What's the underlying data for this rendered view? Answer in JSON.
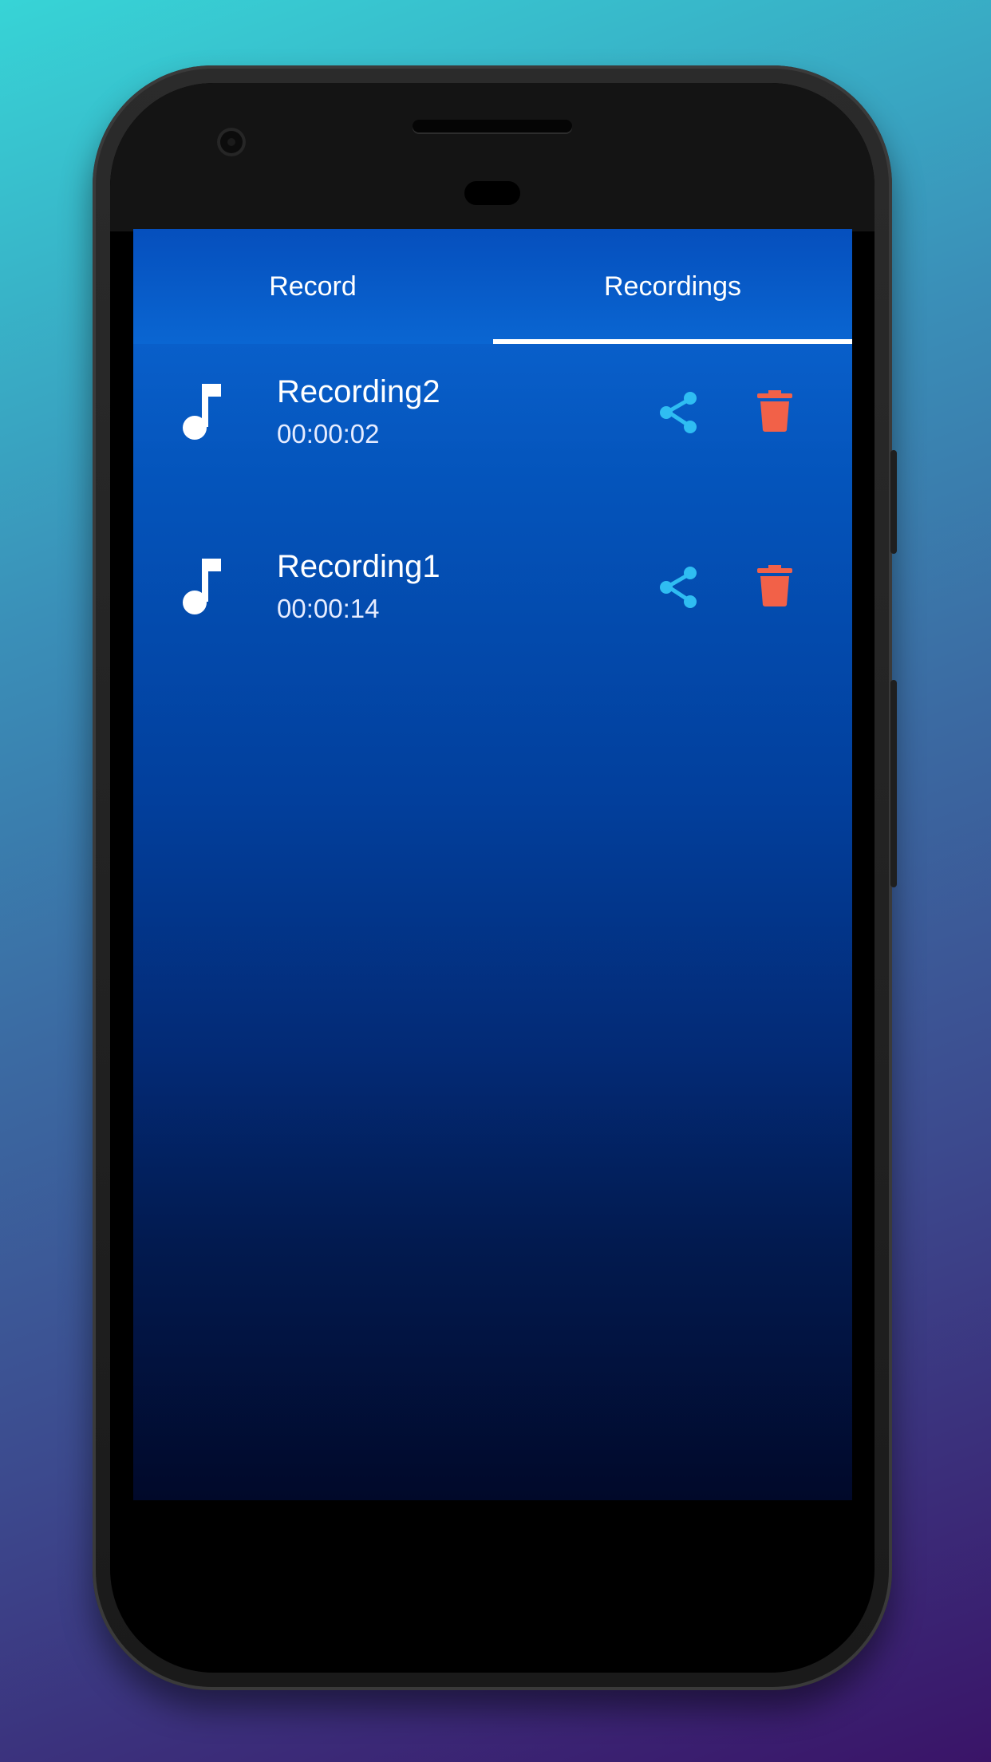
{
  "app": {
    "tabs": [
      {
        "label": "Record"
      },
      {
        "label": "Recordings"
      }
    ],
    "active_tab": "Recordings"
  },
  "recordings": [
    {
      "name": "Recording2",
      "duration": "00:00:02"
    },
    {
      "name": "Recording1",
      "duration": "00:00:14"
    }
  ],
  "icons": {
    "item_icon": "music-note-icon",
    "share_icon": "share-icon",
    "delete_icon": "trash-icon"
  },
  "colors": {
    "share": "#2fbdf2",
    "delete": "#f26148",
    "indicator": "#ffffff"
  }
}
